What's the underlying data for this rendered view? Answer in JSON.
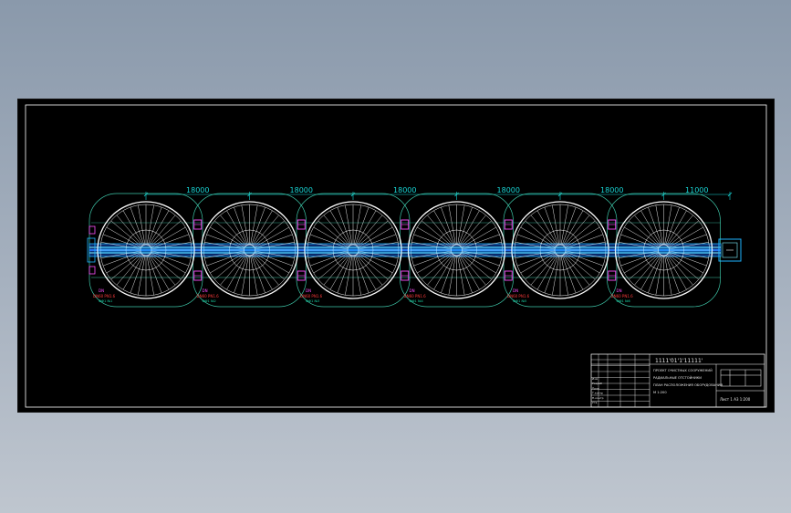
{
  "drawing": {
    "dimension_labels": [
      "18000",
      "18000",
      "18000",
      "18000",
      "18000",
      "11000"
    ],
    "tank_count": 6,
    "spoke_count": 36,
    "tank_labels": [
      {
        "mark": "DN",
        "code": "DN60 PN1.6",
        "note": "ФФ1 №1"
      },
      {
        "mark": "DN",
        "code": "DN60 PN1.6",
        "note": "ФФ1 №2"
      },
      {
        "mark": "DN",
        "code": "DN60 PN1.6",
        "note": "ФФ1 №3"
      },
      {
        "mark": "DN",
        "code": "DN60 PN1.6",
        "note": "ФФ1 №4"
      },
      {
        "mark": "DN",
        "code": "DN60 PN1.6",
        "note": "ФФ1 №5"
      },
      {
        "mark": "DN",
        "code": "DN60 PN1.6",
        "note": "ФФ1 №6"
      }
    ],
    "colors": {
      "sheet": "#000000",
      "tank": "#ffffff",
      "outline": "#3ec7a9",
      "dimension": "#18d6d6",
      "channel": "#1eb3ff",
      "channel_glow": "#7ff2ff",
      "pump": "#ff4fff",
      "border": "#ffffff"
    }
  },
  "title_block": {
    "project": "1111'01'1'11111'",
    "lines": [
      "ПРОЕКТ ОЧИСТНЫХ СООРУЖЕНИЙ",
      "РАДИАЛЬНЫЕ ОТСТОЙНИКИ",
      "ПЛАН РАСПОЛОЖЕНИЯ ОБОРУДОВАНИЯ",
      "М 1:200"
    ],
    "sheet_id": "Лист 1   А3   1:200",
    "row_labels": [
      "Изм",
      "Разраб",
      "Пров",
      "Т.контр",
      "Н.контр",
      "Утв"
    ]
  }
}
